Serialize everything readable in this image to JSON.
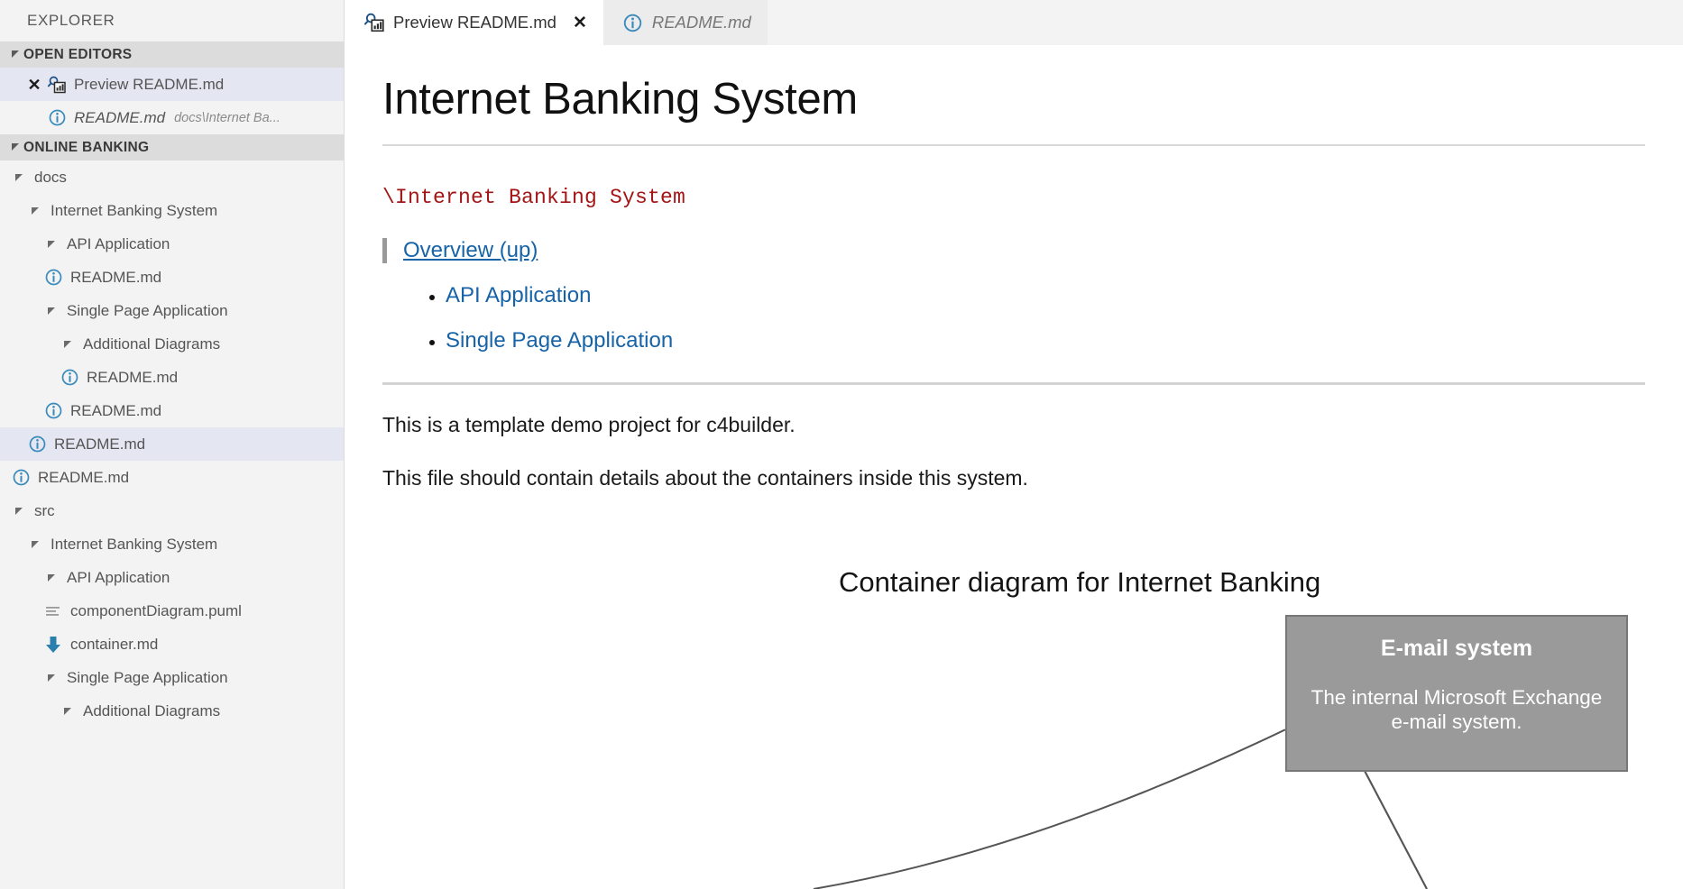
{
  "sidebar": {
    "title": "EXPLORER",
    "open_editors": {
      "label": "OPEN EDITORS",
      "items": [
        {
          "name": "Preview README.md",
          "icon": "preview-icon",
          "detail": "",
          "selected": true,
          "closable": true,
          "italic": false
        },
        {
          "name": "README.md",
          "icon": "info-icon",
          "detail": "docs\\Internet Ba...",
          "selected": false,
          "closable": false,
          "italic": true
        }
      ]
    },
    "workspace": {
      "label": "ONLINE BANKING",
      "items": [
        {
          "name": "docs",
          "icon": "folder-open-twisty",
          "depth": 1,
          "selected": false
        },
        {
          "name": "Internet Banking System",
          "icon": "folder-open-twisty",
          "depth": 2,
          "selected": false
        },
        {
          "name": "API Application",
          "icon": "folder-open-twisty",
          "depth": 3,
          "selected": false
        },
        {
          "name": "README.md",
          "icon": "info-icon",
          "depth": 3,
          "selected": false
        },
        {
          "name": "Single Page Application",
          "icon": "folder-open-twisty",
          "depth": 3,
          "selected": false
        },
        {
          "name": "Additional Diagrams",
          "icon": "folder-open-twisty",
          "depth": 4,
          "selected": false
        },
        {
          "name": "README.md",
          "icon": "info-icon",
          "depth": 4,
          "selected": false
        },
        {
          "name": "README.md",
          "icon": "info-icon",
          "depth": 3,
          "selected": false
        },
        {
          "name": "README.md",
          "icon": "info-icon",
          "depth": 2,
          "selected": true
        },
        {
          "name": "README.md",
          "icon": "info-icon",
          "depth": 1,
          "selected": false
        },
        {
          "name": "src",
          "icon": "folder-open-twisty",
          "depth": 1,
          "selected": false
        },
        {
          "name": "Internet Banking System",
          "icon": "folder-open-twisty",
          "depth": 2,
          "selected": false
        },
        {
          "name": "API Application",
          "icon": "folder-open-twisty",
          "depth": 3,
          "selected": false
        },
        {
          "name": "componentDiagram.puml",
          "icon": "lines-icon",
          "depth": 3,
          "selected": false
        },
        {
          "name": "container.md",
          "icon": "down-arrow-icon",
          "depth": 3,
          "selected": false
        },
        {
          "name": "Single Page Application",
          "icon": "folder-open-twisty",
          "depth": 3,
          "selected": false
        },
        {
          "name": "Additional Diagrams",
          "icon": "folder-open-twisty",
          "depth": 4,
          "selected": false
        }
      ]
    }
  },
  "tabs": [
    {
      "label": "Preview README.md",
      "icon": "preview-icon",
      "active": true,
      "close": "✕"
    },
    {
      "label": "README.md",
      "icon": "info-icon",
      "active": false,
      "close": ""
    }
  ],
  "document": {
    "title": "Internet Banking System",
    "code_line": "\\Internet Banking System",
    "quote_link": "Overview (up)",
    "links": [
      "API Application",
      "Single Page Application"
    ],
    "paragraphs": [
      "This is a template demo project for c4builder.",
      "This file should contain details about the containers inside this system."
    ]
  },
  "diagram": {
    "title": "Container diagram for Internet Banking",
    "nodes": [
      {
        "name": "E-mail system",
        "description": "The internal Microsoft Exchange e-mail system.",
        "fill": "#9a9a9a",
        "border": "#777777",
        "text_color": "#ffffff"
      }
    ]
  },
  "colors": {
    "sidebar_bg": "#f3f3f3",
    "section_bg": "#dcdcdc",
    "selection_bg": "#e4e6f1",
    "link": "#1763a8",
    "code": "#a31515",
    "icon_blue": "#3a8bbb",
    "tab_active_bg": "#ffffff",
    "tab_inactive_bg": "#ececec"
  }
}
